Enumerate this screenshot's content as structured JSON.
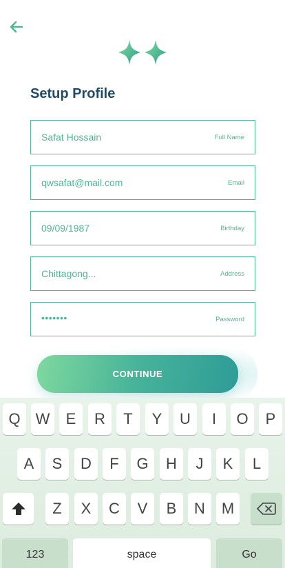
{
  "header": {
    "back_icon": "arrow-left-icon",
    "logo_icon": "sparkle-logo-icon",
    "accent_color": "#4db894"
  },
  "title": "Setup Profile",
  "fields": [
    {
      "value": "Safat Hossain",
      "label": "Full Name"
    },
    {
      "value": "qwsafat@mail.com",
      "label": "Email"
    },
    {
      "value": "09/09/1987",
      "label": "Birthday"
    },
    {
      "value": "Chittagong...",
      "label": "Address"
    },
    {
      "value": "•••••••",
      "label": "Password"
    }
  ],
  "continue_label": "CONTINUE",
  "keyboard": {
    "row1": [
      "Q",
      "W",
      "E",
      "R",
      "T",
      "Y",
      "U",
      "I",
      "O",
      "P"
    ],
    "row2": [
      "A",
      "S",
      "D",
      "F",
      "G",
      "H",
      "J",
      "K",
      "L"
    ],
    "row3": [
      "Z",
      "X",
      "C",
      "V",
      "B",
      "N",
      "M"
    ],
    "shift_icon": "shift-up-arrow-icon",
    "backspace_icon": "backspace-icon",
    "numbers_label": "123",
    "space_label": "space",
    "go_label": "Go"
  }
}
